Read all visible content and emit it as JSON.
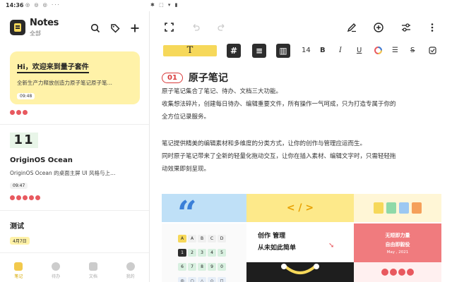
{
  "status": {
    "time": "14:36",
    "left_icons": "◎ ◎ ◎ ···",
    "right_icons": "✱ ⬚ ▾ ▮"
  },
  "app": {
    "title": "Notes",
    "subtitle": "全部"
  },
  "notes": [
    {
      "title": "Hi，欢迎来到量子套件",
      "body": "全新生产力释放创造力原子笔记原子笔…",
      "tag": "09:48"
    },
    {
      "number": "11",
      "title": "OriginOS  Ocean",
      "body": "OriginOS  Ocean  的桌面主屏  UI  风格与上…",
      "tag": "09:47"
    },
    {
      "title": "测试",
      "tag": "4月7日"
    }
  ],
  "nav": [
    {
      "label": "笔记",
      "active": true
    },
    {
      "label": "待办",
      "active": false
    },
    {
      "label": "文档",
      "active": false
    },
    {
      "label": "我的",
      "active": false
    }
  ],
  "toolbar": {
    "font_size": "14",
    "bold": "B",
    "italic": "I",
    "underline": "U",
    "text_style": "T"
  },
  "doc": {
    "heading_num": "01",
    "heading": "原子笔记",
    "p1": "原子笔记集合了笔记、待办、文档三大功能。",
    "p2": "收集想法碎片，创建每日待办、编辑重要文件，所有操作一气呵成，只为打造专属于你的",
    "p3": "全方位记录服务。",
    "p4": "笔记提供精美的编辑素材和多维度的分类方式，让你的创作与管理应运而生。",
    "p5": "同时原子笔记带来了全新的轻量化拖动交互，让你在插入素材、编辑文字时，只需轻轻拖",
    "p6": "动效果即刻呈现。"
  },
  "gallery": {
    "code": "< / >",
    "create_line1": "创作  管理",
    "create_line2": "从未如此简单",
    "right_line1": "无短即力量",
    "right_line2": "自由即毅役",
    "right_line3": "May , 2021",
    "keys_row1": [
      "A",
      "A",
      "B",
      "C",
      "D"
    ],
    "keys_row2": [
      "1",
      "2",
      "3",
      "4",
      "5"
    ],
    "keys_row3": [
      "6",
      "7",
      "8",
      "9",
      "0"
    ]
  }
}
